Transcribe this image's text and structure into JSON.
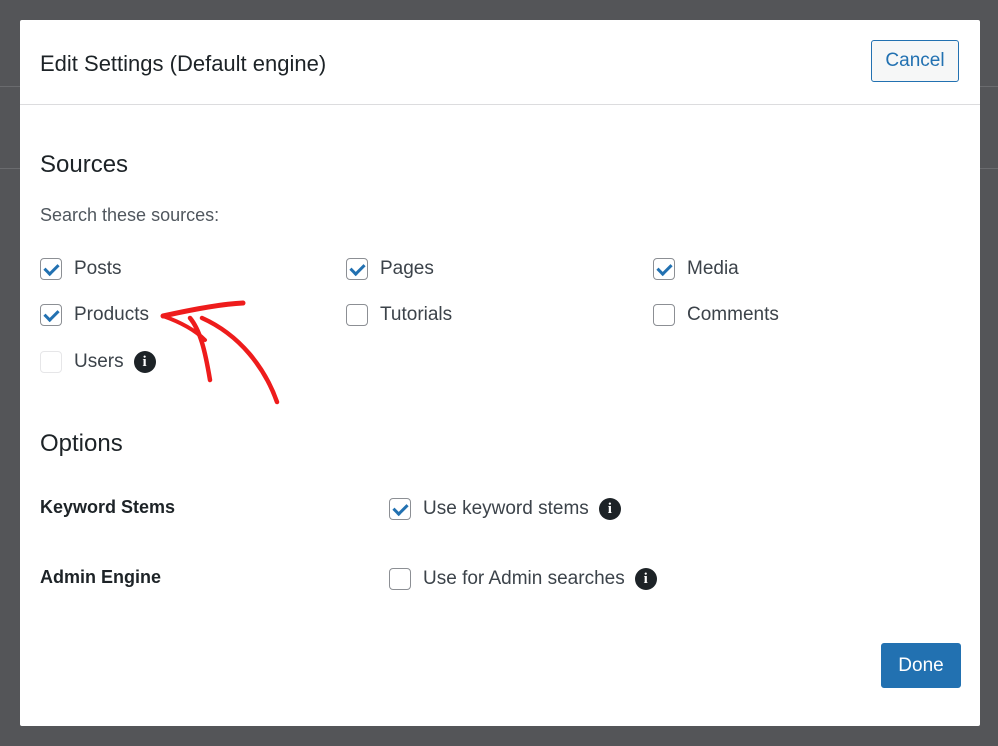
{
  "modal": {
    "title": "Edit Settings (Default engine)",
    "cancel_label": "Cancel",
    "done_label": "Done"
  },
  "sources": {
    "heading": "Sources",
    "hint": "Search these sources:",
    "items": [
      {
        "label": "Posts",
        "checked": true
      },
      {
        "label": "Pages",
        "checked": true
      },
      {
        "label": "Media",
        "checked": true
      },
      {
        "label": "Products",
        "checked": true
      },
      {
        "label": "Tutorials",
        "checked": false
      },
      {
        "label": "Comments",
        "checked": false
      },
      {
        "label": "Users",
        "checked": false,
        "disabled": true,
        "info_icon": "info-icon"
      }
    ]
  },
  "options": {
    "heading": "Options",
    "rows": [
      {
        "label": "Keyword Stems",
        "checkbox_label": "Use keyword stems",
        "checked": true,
        "info_icon": "info-icon"
      },
      {
        "label": "Admin Engine",
        "checkbox_label": "Use for Admin searches",
        "checked": false,
        "info_icon": "info-icon"
      }
    ]
  },
  "annotation": {
    "icon": "red-arrow-icon",
    "color": "#ee1c1c"
  },
  "colors": {
    "accent": "#2271b1",
    "overlay": "#545558",
    "modal_bg": "#ffffff"
  }
}
